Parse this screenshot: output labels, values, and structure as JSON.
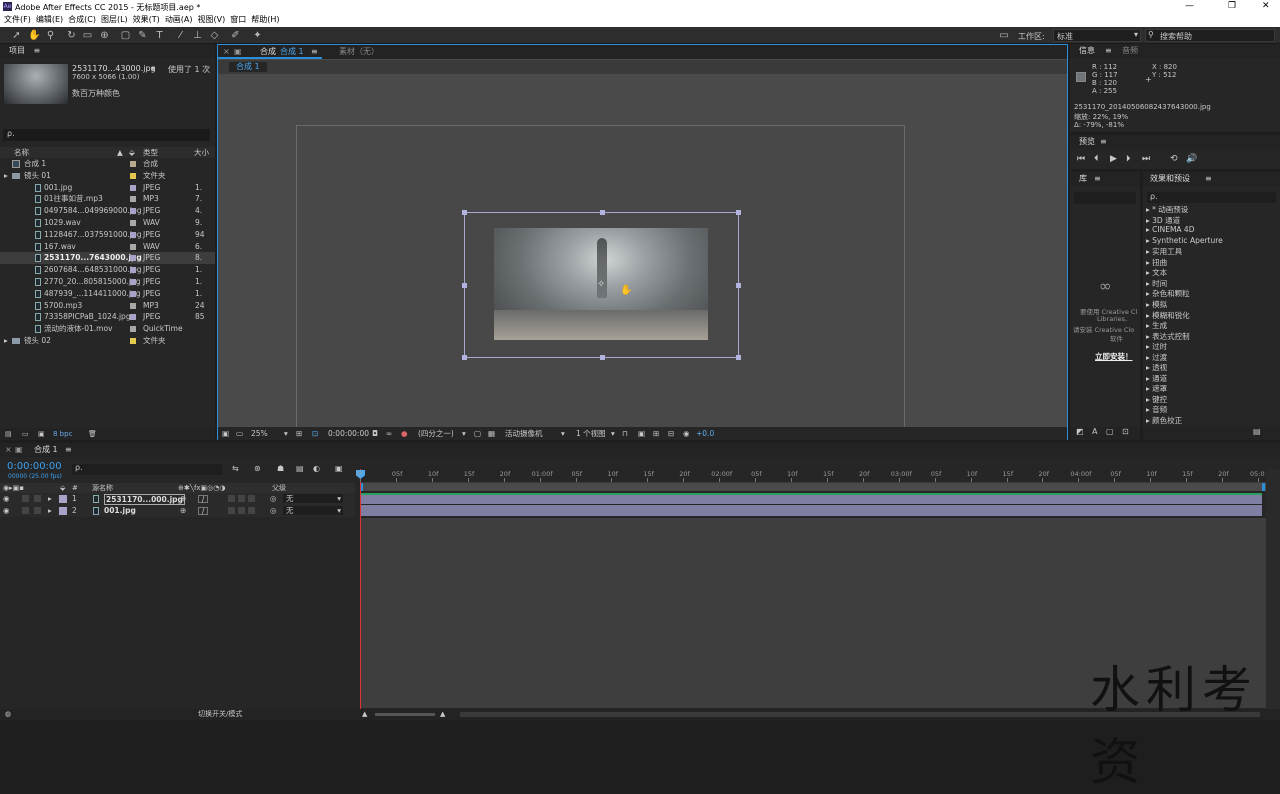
{
  "window": {
    "title": "Adobe After Effects CC 2015 - 无标题项目.aep *",
    "min": "—",
    "max": "❐",
    "close": "✕"
  },
  "menu": [
    "文件(F)",
    "编辑(E)",
    "合成(C)",
    "图层(L)",
    "效果(T)",
    "动画(A)",
    "视图(V)",
    "窗口",
    "帮助(H)"
  ],
  "toolbar": {
    "workspace_label": "工作区:",
    "workspace_value": "标准",
    "search_help": "搜索帮助"
  },
  "project": {
    "title": "项目",
    "preview_name": "2531170...43000.jpg",
    "preview_used": "使用了 1 次",
    "preview_size": "7600 x 5066 (1.00)",
    "preview_colors": "数百万种颜色",
    "search_placeholder": "ρ.",
    "col_name": "名称",
    "col_type": "类型",
    "col_size": "大小",
    "bpc": "8 bpc",
    "rows": [
      {
        "name": "合成 1",
        "type": "合成",
        "size": "",
        "color": "#b9a98f",
        "indent": 0,
        "kind": "comp"
      },
      {
        "name": "镜头 01",
        "type": "文件夹",
        "size": "",
        "color": "#e3c94e",
        "indent": 0,
        "kind": "folder"
      },
      {
        "name": "001.jpg",
        "type": "JPEG",
        "size": "1.",
        "color": "#a7a3c9",
        "indent": 1,
        "kind": "file"
      },
      {
        "name": "01往事如昔.mp3",
        "type": "MP3",
        "size": "7.",
        "color": "#a7a7a7",
        "indent": 1,
        "kind": "file"
      },
      {
        "name": "0497584...049969000.jpg",
        "type": "JPEG",
        "size": "4.",
        "color": "#a7a3c9",
        "indent": 1,
        "kind": "file"
      },
      {
        "name": "1029.wav",
        "type": "WAV",
        "size": "9.",
        "color": "#a7a7a7",
        "indent": 1,
        "kind": "file"
      },
      {
        "name": "1128467...037591000.jpg",
        "type": "JPEG",
        "size": "94",
        "color": "#a7a3c9",
        "indent": 1,
        "kind": "file"
      },
      {
        "name": "167.wav",
        "type": "WAV",
        "size": "6.",
        "color": "#a7a7a7",
        "indent": 1,
        "kind": "file"
      },
      {
        "name": "2531170...7643000.jpg",
        "type": "JPEG",
        "size": "8.",
        "color": "#a7a3c9",
        "indent": 1,
        "kind": "file",
        "selected": true
      },
      {
        "name": "2607684...648531000.jpg",
        "type": "JPEG",
        "size": "1.",
        "color": "#a7a3c9",
        "indent": 1,
        "kind": "file"
      },
      {
        "name": "2770_20...805815000.jpg",
        "type": "JPEG",
        "size": "1.",
        "color": "#a7a3c9",
        "indent": 1,
        "kind": "file"
      },
      {
        "name": "487939_...114411000.jpg",
        "type": "JPEG",
        "size": "1.",
        "color": "#a7a3c9",
        "indent": 1,
        "kind": "file"
      },
      {
        "name": "5700.mp3",
        "type": "MP3",
        "size": "24",
        "color": "#a7a7a7",
        "indent": 1,
        "kind": "file"
      },
      {
        "name": "73358PICPaB_1024.jpg",
        "type": "JPEG",
        "size": "85",
        "color": "#a7a3c9",
        "indent": 1,
        "kind": "file"
      },
      {
        "name": "流动的液体-01.mov",
        "type": "QuickTime",
        "size": "",
        "color": "#a7a7a7",
        "indent": 1,
        "kind": "file"
      },
      {
        "name": "镜头 02",
        "type": "文件夹",
        "size": "",
        "color": "#e3c94e",
        "indent": 0,
        "kind": "folder"
      }
    ]
  },
  "comp_viewer": {
    "tab_label": "合成",
    "tab_comp": "合成 1",
    "footage_tab": "素材（无）",
    "breadcrumb": "合成 1",
    "zoom": "25%",
    "timecode": "0:00:00:00",
    "resolution": "(四分之一)",
    "camera": "活动摄像机",
    "views": "1 个视图",
    "exposure": "+0.0"
  },
  "info": {
    "tab_info": "信息",
    "tab_audio": "音频",
    "r": "R : 112",
    "g": "G : 117",
    "b": "B : 120",
    "a": "A : 255",
    "x": "X : 820",
    "y": "Y : 512",
    "filename": "2531170_20140506082437643000.jpg",
    "scale": "缩放: 22%, 19%",
    "delta": "Δ: -79%, -81%"
  },
  "preview_panel": {
    "title": "预览"
  },
  "library": {
    "title": "库",
    "notice1": "要使用 Creative Cl",
    "notice2": "Libraries,",
    "notice3": "请安装 Creative Clo",
    "notice4": "软件",
    "install_link": "立即安装！"
  },
  "effects": {
    "title": "效果和预设",
    "search_placeholder": "ρ.",
    "items": [
      "* 动画预设",
      "3D 通道",
      "CINEMA 4D",
      "Synthetic Aperture",
      "实用工具",
      "扭曲",
      "文本",
      "时间",
      "杂色和颗粒",
      "模拟",
      "模糊和锐化",
      "生成",
      "表达式控制",
      "过时",
      "过渡",
      "透视",
      "通道",
      "遮罩",
      "键控",
      "音频",
      "颜色校正"
    ]
  },
  "timeline": {
    "tab": "合成 1",
    "timecode": "0:00:00:00",
    "timecode_sub": "00000 (25.00 fps)",
    "col_layername": "源名称",
    "col_parent": "父级",
    "footer": "切换开关/模式",
    "ticks": [
      "0f",
      "05f",
      "10f",
      "15f",
      "20f",
      "01:00f",
      "05f",
      "10f",
      "15f",
      "20f",
      "02:00f",
      "05f",
      "10f",
      "15f",
      "20f",
      "03:00f",
      "05f",
      "10f",
      "15f",
      "20f",
      "04:00f",
      "05f",
      "10f",
      "15f",
      "20f",
      "05:0"
    ],
    "layers": [
      {
        "num": "1",
        "name": "2531170...000.jpg",
        "parent": "无"
      },
      {
        "num": "2",
        "name": "001.jpg",
        "parent": "无"
      }
    ]
  },
  "watermark": "水利考资",
  "colors": {
    "accent": "#2a8fd8",
    "selection": "#8a8ab8",
    "track": "#7f7fa3"
  }
}
